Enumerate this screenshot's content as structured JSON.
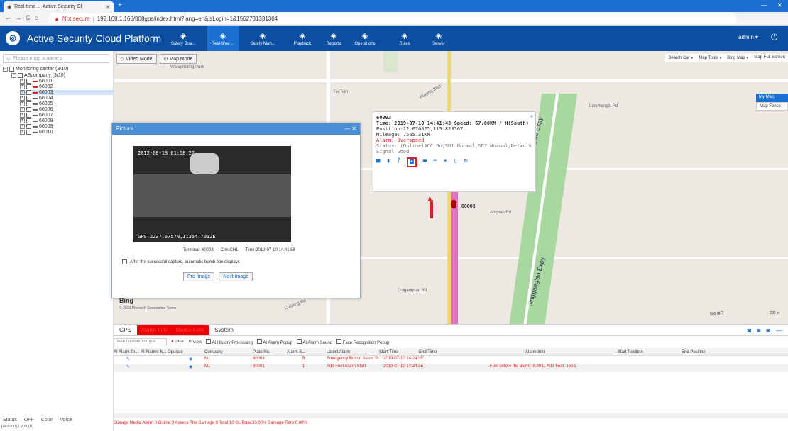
{
  "browser": {
    "tab_title": "Real-time ...-Active Security Cl",
    "url_warning": "Not secure",
    "url": "192.168.1.166/808gps/index.html?lang=en&isLogin=1&1562731331304"
  },
  "app": {
    "title": "Active Security Cloud Platform",
    "user": "admin ▾",
    "nav": [
      "Safety Boa...",
      "Real-time ...",
      "Safety Man...",
      "Playback",
      "Reports",
      "Operations",
      "Rules",
      "Server"
    ]
  },
  "sidebar": {
    "search_placeholder": "Please enter a name o",
    "root": "Monitoring center (3/10)",
    "company": "AScompany (3/10)",
    "vehicles": [
      "60001",
      "60002",
      "60003",
      "60004",
      "60005",
      "60006",
      "60007",
      "60008",
      "60009",
      "60010"
    ],
    "footer": [
      "Status",
      "OFF",
      "Color",
      "Voice"
    ],
    "statusbar": "javascript:void(0)"
  },
  "map": {
    "video_mode": "Video Mode",
    "map_mode": "Map Mode",
    "tools": [
      "Search Car ▾",
      "Map Tools ▾",
      "Bing Map ▾",
      "Map Full Screen"
    ],
    "layers": [
      "My Map",
      "Map Fence"
    ],
    "labels": [
      "Wangmuting Park",
      "Fu Tian",
      "Jingang'ao Expy",
      "Jinggang'ao Expy",
      "Longhengzi Rd",
      "Anquan Rd",
      "Cuigangsan Rd",
      "Cuigang Rd",
      "Fuyong Blvd"
    ],
    "marker": "60003",
    "bing": "Bing",
    "copyright": "© 2019 Microsoft Corporation  Terms",
    "scale": [
      "500 英尺",
      "200 m"
    ]
  },
  "picture": {
    "title": "Picture",
    "overlay_top": "2012-08-18  01:58:27",
    "overlay_gps": "GPS:2237.6757N,11354.7012E",
    "terminal": "Terminal: 60003",
    "channel": "Chn:CH1",
    "time": "Time:2019-07-10 14:41:58",
    "auto_label": "After the successful capture, automatic bomb box displays",
    "pre": "Pre Image",
    "next": "Next Image"
  },
  "info": {
    "id": "60003",
    "time": "Time: 2019-07-10 14:41:43  Speed: 67.00KM / H(South)",
    "position": "Position:22.670825,113.823567",
    "mileage": "Mileage: 7565.31KM",
    "alarm": "Alarm: Overspeed",
    "status": "Status: (Online)ACC On,SD1 Normal,SD2 Normal,Network Signal Good"
  },
  "bottom": {
    "tabs": [
      "GPS",
      "Alarm Info",
      "Media Files",
      "System"
    ],
    "filter_placeholder": "plate number/compar",
    "clear": "clear",
    "view": "View",
    "checks": [
      "AI History Processing",
      "AI Alarm Popup",
      "AI Alarm Sound",
      "Face Recognition Popup"
    ],
    "headers": [
      "AI Alarm Pr...",
      "AI Alarms N...",
      "Operate",
      "Company",
      "Plate No.",
      "Alarm S...",
      "Latest Alarm",
      "Start Time",
      "End Time",
      "Alarm Info",
      "Start Position",
      "End Position"
    ],
    "rows": [
      {
        "company": "M1",
        "plate": "60003",
        "count": "5",
        "latest": "Emergency Button Alarm St",
        "start": "2019-07-10 14:24:3E",
        "info": ""
      },
      {
        "company": "M1",
        "plate": "60001",
        "count": "1",
        "latest": "Add Fuel Alarm Start",
        "start": "2019-07-10 14:24:3E",
        "info": "Fuel before the alarm: 9.99 L, Add Fuel: 150 L"
      }
    ],
    "status": "Storage Media Alarm:0  Online:3  Assess The Damage:0  Total:10  OL Rate:30.00%  Damage Rate:0.00%"
  }
}
